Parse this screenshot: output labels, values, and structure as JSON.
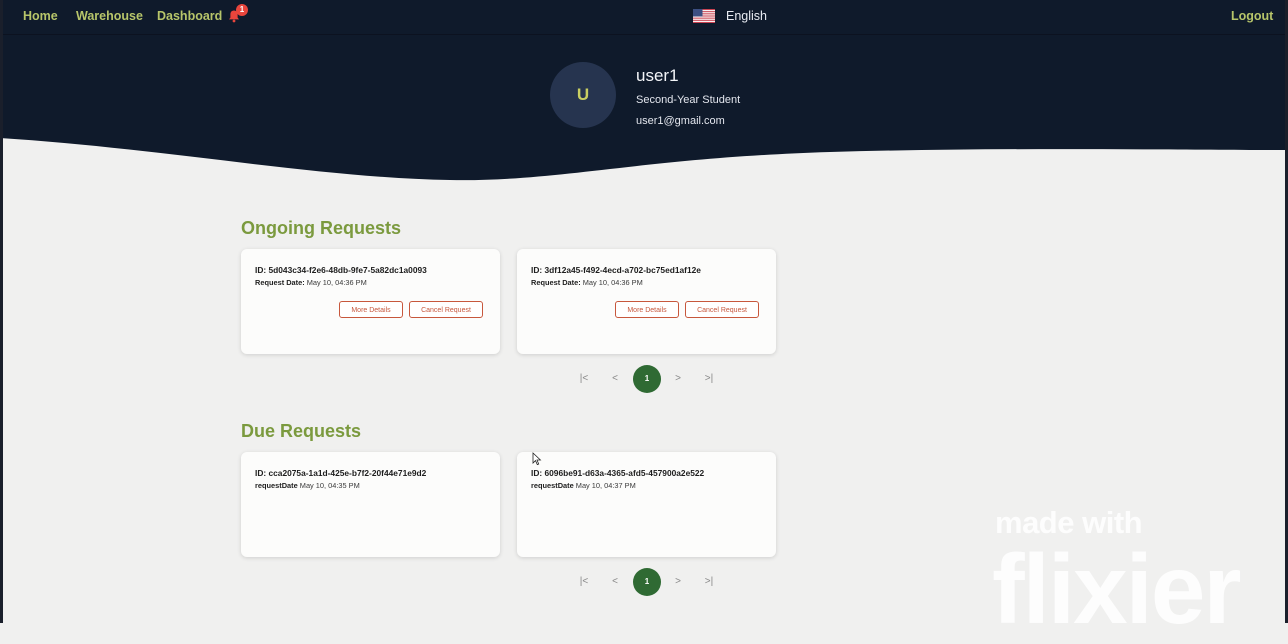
{
  "nav": {
    "home": "Home",
    "warehouse": "Warehouse",
    "dashboard": "Dashboard",
    "notification_count": "1",
    "language": "English",
    "logout": "Logout"
  },
  "profile": {
    "initial": "U",
    "name": "user1",
    "role": "Second-Year Student",
    "email": "user1@gmail.com"
  },
  "ongoing": {
    "title": "Ongoing Requests",
    "date_label": "Request Date:",
    "more_label": "More Details",
    "cancel_label": "Cancel Request",
    "cards": [
      {
        "id": "ID: 5d043c34-f2e6-48db-9fe7-5a82dc1a0093",
        "date": "May 10, 04:36 PM"
      },
      {
        "id": "ID: 3df12a45-f492-4ecd-a702-bc75ed1af12e",
        "date": "May 10, 04:36 PM"
      }
    ],
    "page": "1"
  },
  "due": {
    "title": "Due Requests",
    "date_label": "requestDate",
    "cards": [
      {
        "id": "ID: cca2075a-1a1d-425e-b7f2-20f44e71e9d2",
        "date": "May 10, 04:35 PM"
      },
      {
        "id": "ID: 6096be91-d63a-4365-afd5-457900a2e522",
        "date": "May 10, 04:37 PM"
      }
    ],
    "page": "1"
  },
  "pager_icons": {
    "first": "|<",
    "prev": "<",
    "next": ">",
    "last": ">|"
  },
  "watermark": {
    "line1": "made with",
    "line2": "flixier"
  },
  "colors": {
    "header_bg": "#0f1a2b",
    "nav_link": "#b7c56a",
    "section_title": "#7b9a3e",
    "button_outline": "#c7573c",
    "pager_active": "#2f6a33"
  }
}
